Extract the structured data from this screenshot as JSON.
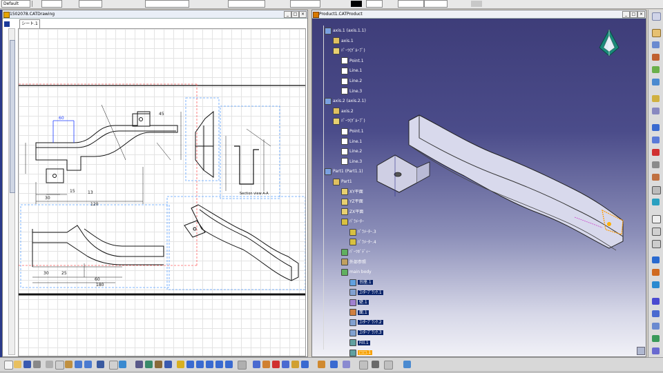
{
  "toolbar": {
    "style_combo": "Default",
    "icons": [
      "select-icon",
      "properties-icon",
      "color-icon",
      "line-type-icon",
      "layer-icon"
    ]
  },
  "drawing_window": {
    "title": "1502078.CATDrawing",
    "sheet_tab": "シート.1",
    "dims": {
      "d60": "60",
      "d30": "30",
      "d15": "15",
      "d120": "120",
      "d45": "45",
      "d13": "13",
      "d25": "25",
      "d180": "180",
      "section_label": "Section view A-A"
    }
  },
  "product_window": {
    "title": "Product1.CATProduct",
    "tree": [
      {
        "label": "axis.1 (axis.1.1)",
        "indent": 0,
        "icon": "assembly-icon",
        "style": ""
      },
      {
        "label": "axis.1",
        "indent": 1,
        "icon": "part-icon",
        "style": ""
      },
      {
        "label": "ﾊﾟｰﾂ(ｸﾞﾙｰﾌﾟ)",
        "indent": 1,
        "icon": "folder-icon",
        "style": ""
      },
      {
        "label": "Point.1",
        "indent": 2,
        "icon": "point-icon",
        "style": ""
      },
      {
        "label": "Line.1",
        "indent": 2,
        "icon": "line-icon",
        "style": ""
      },
      {
        "label": "Line.2",
        "indent": 2,
        "icon": "line-icon",
        "style": ""
      },
      {
        "label": "Line.3",
        "indent": 2,
        "icon": "line-icon",
        "style": ""
      },
      {
        "label": "axis.2 (axis.2.1)",
        "indent": 0,
        "icon": "assembly-icon",
        "style": ""
      },
      {
        "label": "axis.2",
        "indent": 1,
        "icon": "part-icon",
        "style": ""
      },
      {
        "label": "ﾊﾟｰﾂ(ｸﾞﾙｰﾌﾟ)",
        "indent": 1,
        "icon": "folder-icon",
        "style": ""
      },
      {
        "label": "Point.1",
        "indent": 2,
        "icon": "point-icon",
        "style": ""
      },
      {
        "label": "Line.1",
        "indent": 2,
        "icon": "line-icon",
        "style": ""
      },
      {
        "label": "Line.2",
        "indent": 2,
        "icon": "line-icon",
        "style": ""
      },
      {
        "label": "Line.3",
        "indent": 2,
        "icon": "line-icon",
        "style": ""
      },
      {
        "label": "Part1 (Part1.1)",
        "indent": 0,
        "icon": "assembly-icon",
        "style": ""
      },
      {
        "label": "Part1",
        "indent": 1,
        "icon": "part-icon",
        "style": ""
      },
      {
        "label": "XY平面",
        "indent": 2,
        "icon": "plane-icon",
        "style": ""
      },
      {
        "label": "YZ平面",
        "indent": 2,
        "icon": "plane-icon",
        "style": ""
      },
      {
        "label": "ZX平面",
        "indent": 2,
        "icon": "plane-icon",
        "style": ""
      },
      {
        "label": "ﾊﾟﾗﾒｰﾀｰ",
        "indent": 2,
        "icon": "parameter-icon",
        "style": ""
      },
      {
        "label": "ﾊﾟﾗﾒｰﾀｰ.3",
        "indent": 3,
        "icon": "parameter-icon",
        "style": ""
      },
      {
        "label": "ﾊﾟﾗﾒｰﾀｰ.4",
        "indent": 3,
        "icon": "parameter-icon",
        "style": ""
      },
      {
        "label": "ﾊﾟｰﾂﾎﾞﾃﾞｨｰ",
        "indent": 2,
        "icon": "body-icon",
        "style": ""
      },
      {
        "label": "外部参照",
        "indent": 2,
        "icon": "reference-icon",
        "style": ""
      },
      {
        "label": "main body",
        "indent": 2,
        "icon": "body-icon",
        "style": ""
      },
      {
        "label": "台座.1",
        "indent": 3,
        "icon": "pad-icon",
        "style": "hl"
      },
      {
        "label": "ｺﾝﾀｰﾌﾞﾗﾝｸ.1",
        "indent": 3,
        "icon": "feature-icon",
        "style": "hl"
      },
      {
        "label": "壁.1",
        "indent": 3,
        "icon": "wall-icon",
        "style": "hl"
      },
      {
        "label": "面.1",
        "indent": 3,
        "icon": "face-icon",
        "style": "hl"
      },
      {
        "label": "ｺﾝﾀｰﾌﾞﾗﾝｸ.2",
        "indent": 3,
        "icon": "feature-icon",
        "style": "hl"
      },
      {
        "label": "ｺﾝﾀｰﾌﾞﾗﾝｸ.3",
        "indent": 3,
        "icon": "feature-icon",
        "style": "hl"
      },
      {
        "label": "Fill.1",
        "indent": 3,
        "icon": "fill-icon",
        "style": "hl"
      },
      {
        "label": "□□.1",
        "indent": 3,
        "icon": "fill-icon",
        "style": "hlo"
      }
    ]
  },
  "colors": {
    "drawing_bg": "#ffffff",
    "viewport_top": "#3d3c78",
    "viewport_bottom": "#f1f1f7",
    "highlight": "#0a246a",
    "selected": "#f7a100"
  }
}
